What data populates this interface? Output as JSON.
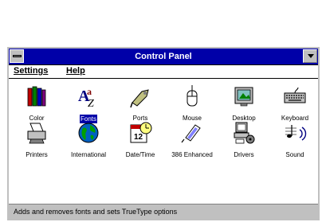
{
  "window": {
    "title": "Control Panel"
  },
  "menubar": {
    "settings": "Settings",
    "help": "Help"
  },
  "icons": [
    {
      "label": "Color"
    },
    {
      "label": "Fonts"
    },
    {
      "label": "Ports"
    },
    {
      "label": "Mouse"
    },
    {
      "label": "Desktop"
    },
    {
      "label": "Keyboard"
    },
    {
      "label": "Printers"
    },
    {
      "label": "International"
    },
    {
      "label": "Date/Time"
    },
    {
      "label": "386 Enhanced"
    },
    {
      "label": "Drivers"
    },
    {
      "label": "Sound"
    }
  ],
  "status": {
    "text": "Adds and removes fonts and sets TrueType options"
  },
  "colors": {
    "titlebar": "#0000a8",
    "selection": "#0000a8",
    "status_bg": "#c0c0c0"
  }
}
